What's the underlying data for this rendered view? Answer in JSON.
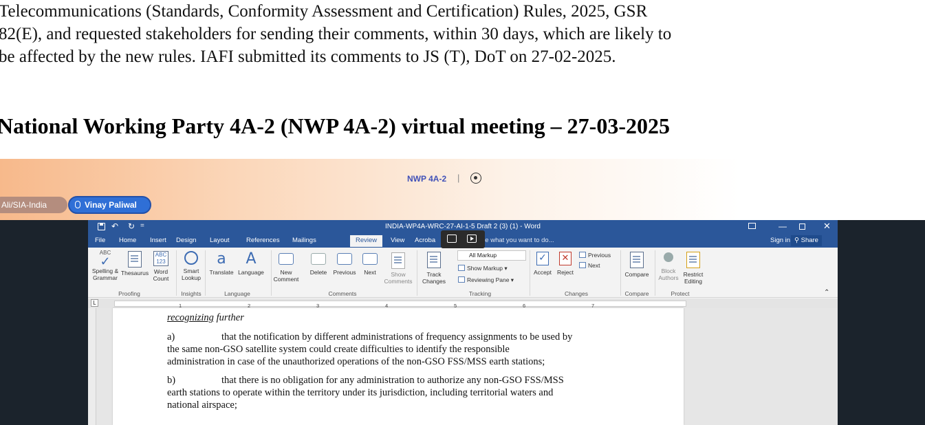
{
  "document": {
    "paragraph_lines": [
      "Telecommunications (Standards, Conformity Assessment and Certification) Rules, 2025, GSR",
      "82(E), and requested stakeholders for sending their comments, within 30 days, which are likely to",
      "be affected by the new rules. IAFI submitted its comments to JS (T), DoT on 27-02-2025."
    ],
    "heading": "National Working Party 4A-2 (NWP 4A-2) virtual meeting – 27-03-2025"
  },
  "meeting": {
    "title": "NWP 4A-2",
    "separator": "|",
    "participants": [
      "Ali/SIA-India",
      "Vinay Paliwal"
    ]
  },
  "word": {
    "window_title": "INDIA-WP4A-WRC-27-AI-1-5 Draft 2 (3) (1) - Word",
    "quick_access": {
      "undo": "↶",
      "redo": "↻",
      "customize": "="
    },
    "window_controls": {
      "minimize": "—",
      "close": "✕"
    },
    "tabs": [
      "File",
      "Home",
      "Insert",
      "Design",
      "Layout",
      "References",
      "Mailings",
      "Review",
      "View",
      "Acroba"
    ],
    "active_tab": "Review",
    "tell_me": "he what you want to do...",
    "sign_in": "Sign in",
    "share": "Share",
    "ribbon": {
      "spelling": [
        "Spelling &",
        "Grammar"
      ],
      "thesaurus": "Thesaurus",
      "word_count": [
        "Word",
        "Count"
      ],
      "smart_lookup": [
        "Smart",
        "Lookup"
      ],
      "translate": "Translate",
      "language": "Language",
      "new_comment": [
        "New",
        "Comment"
      ],
      "delete": "Delete",
      "previous": "Previous",
      "next": "Next",
      "show_comments": [
        "Show",
        "Comments"
      ],
      "track_changes": [
        "Track",
        "Changes"
      ],
      "markup_dropdown": "All Markup",
      "show_markup": "Show Markup",
      "reviewing_pane": "Reviewing Pane",
      "accept": "Accept",
      "reject": "Reject",
      "prev_change": "Previous",
      "next_change": "Next",
      "compare": "Compare",
      "block_authors": [
        "Block",
        "Authors"
      ],
      "restrict_editing": [
        "Restrict",
        "Editing"
      ],
      "icon_text": {
        "abc": "ABC",
        "abc123_top": "ABC",
        "abc123_bottom": "123",
        "translate_glyph": "a",
        "language_glyph": "A"
      },
      "groups": [
        "Proofing",
        "Insights",
        "Language",
        "Comments",
        "Tracking",
        "Changes",
        "Compare",
        "Protect"
      ]
    },
    "ruler_tab": "L",
    "ruler_numbers": [
      "1",
      "2",
      "3",
      "4",
      "5",
      "6",
      "7"
    ],
    "doc": {
      "heading": [
        "recognizing",
        " further"
      ],
      "item_a": {
        "label": "a)",
        "line1": "that the notification by different administrations of frequency assignments to be used by",
        "line2": "the same non-GSO satellite system could create difficulties to identify the responsible",
        "line3": "administration in case of the unauthorized operations of the non-GSO FSS/MSS earth stations;"
      },
      "item_b": {
        "label": "b)",
        "line1": "that there is no obligation for any administration to authorize any non-GSO FSS/MSS",
        "line2": "earth stations to operate within the territory under its jurisdiction, including territorial waters and",
        "line3": "national airspace;"
      }
    }
  }
}
